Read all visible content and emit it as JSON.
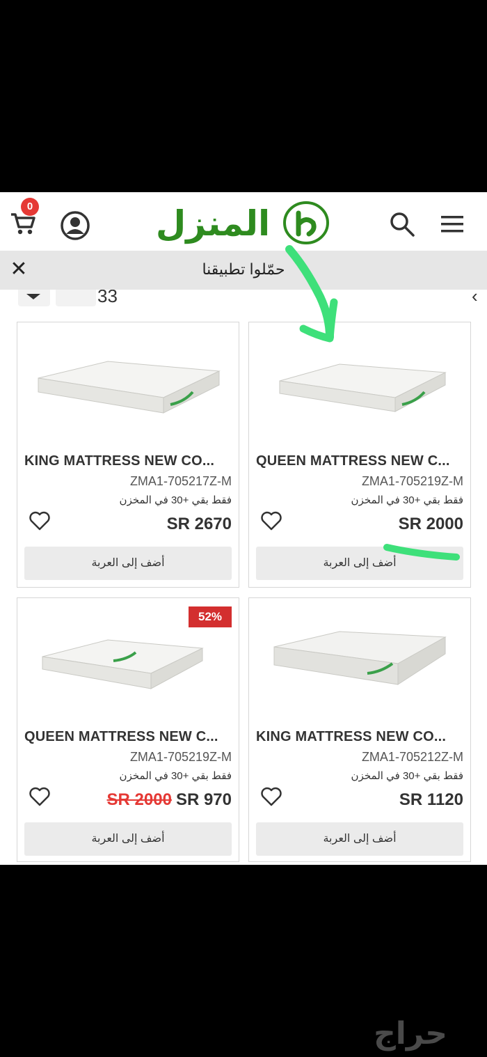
{
  "header": {
    "cart_count": "0",
    "logo_text": "المنزل"
  },
  "banner": {
    "close_symbol": "✕",
    "text": "حمّلوا تطبيقنا"
  },
  "sort_row": {
    "partial_text": "33"
  },
  "products": [
    {
      "title": "KING MATTRESS NEW CO...",
      "sku": "ZMA1-705217Z-M",
      "stock": "فقط بقي +30 في المخزن",
      "price": "SR 2670",
      "old_price": "",
      "discount": "",
      "add_label": "أضف إلى العربة"
    },
    {
      "title": "QUEEN MATTRESS NEW C...",
      "sku": "ZMA1-705219Z-M",
      "stock": "فقط بقي +30 في المخزن",
      "price": "SR 2000",
      "old_price": "",
      "discount": "",
      "add_label": "أضف إلى العربة"
    },
    {
      "title": "QUEEN MATTRESS NEW C...",
      "sku": "ZMA1-705219Z-M",
      "stock": "فقط بقي +30 في المخزن",
      "price": "SR 970",
      "old_price": "SR 2000",
      "discount": "52%",
      "add_label": "أضف إلى العربة"
    },
    {
      "title": "KING MATTRESS NEW CO...",
      "sku": "ZMA1-705212Z-M",
      "stock": "فقط بقي +30 في المخزن",
      "price": "SR 1120",
      "old_price": "",
      "discount": "",
      "add_label": "أضف إلى العربة"
    }
  ],
  "watermark": "حراج",
  "colors": {
    "brand_green": "#2e8b1f",
    "badge_red": "#e53935",
    "annotation_green": "#3ee07a"
  },
  "icons": [
    "cart-icon",
    "account-icon",
    "search-icon",
    "menu-icon",
    "close-icon",
    "heart-icon"
  ]
}
